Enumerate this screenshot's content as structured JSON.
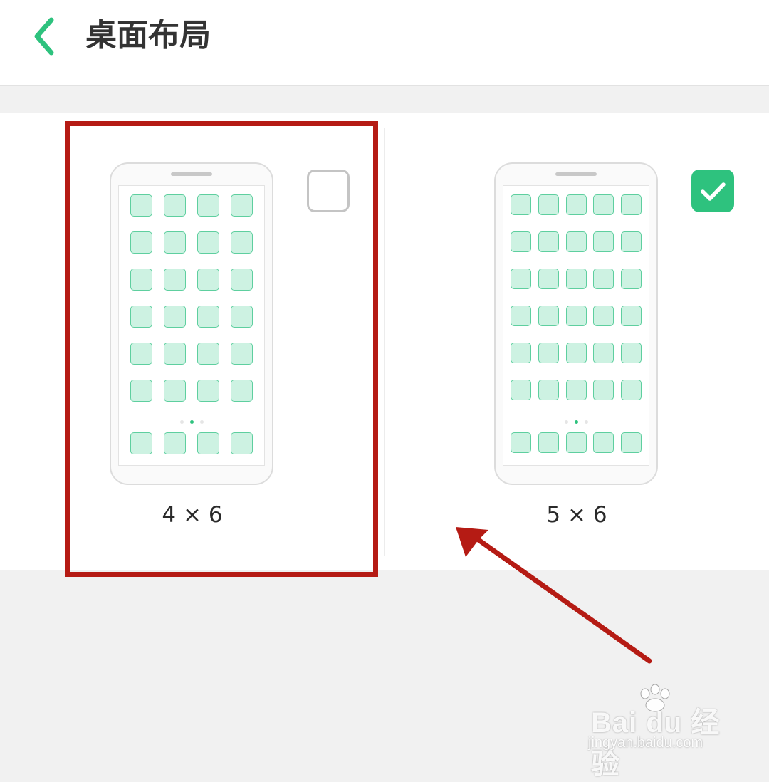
{
  "header": {
    "title": "桌面布局",
    "back_icon": "chevron-left-icon",
    "accent_color": "#2ec27e"
  },
  "layout_options": [
    {
      "label": "4 × 6",
      "columns": 4,
      "rows": 6,
      "dock_icons": 4,
      "selected": false,
      "page_indicator": {
        "count": 3,
        "active": 2
      }
    },
    {
      "label": "5 × 6",
      "columns": 5,
      "rows": 6,
      "dock_icons": 5,
      "selected": true,
      "page_indicator": {
        "count": 3,
        "active": 2
      }
    }
  ],
  "annotation": {
    "color": "#b51b14",
    "highlighted_option": "4 × 6"
  },
  "watermark": {
    "brand": "Bai du 经验",
    "url": "jingyan.baidu.com"
  }
}
